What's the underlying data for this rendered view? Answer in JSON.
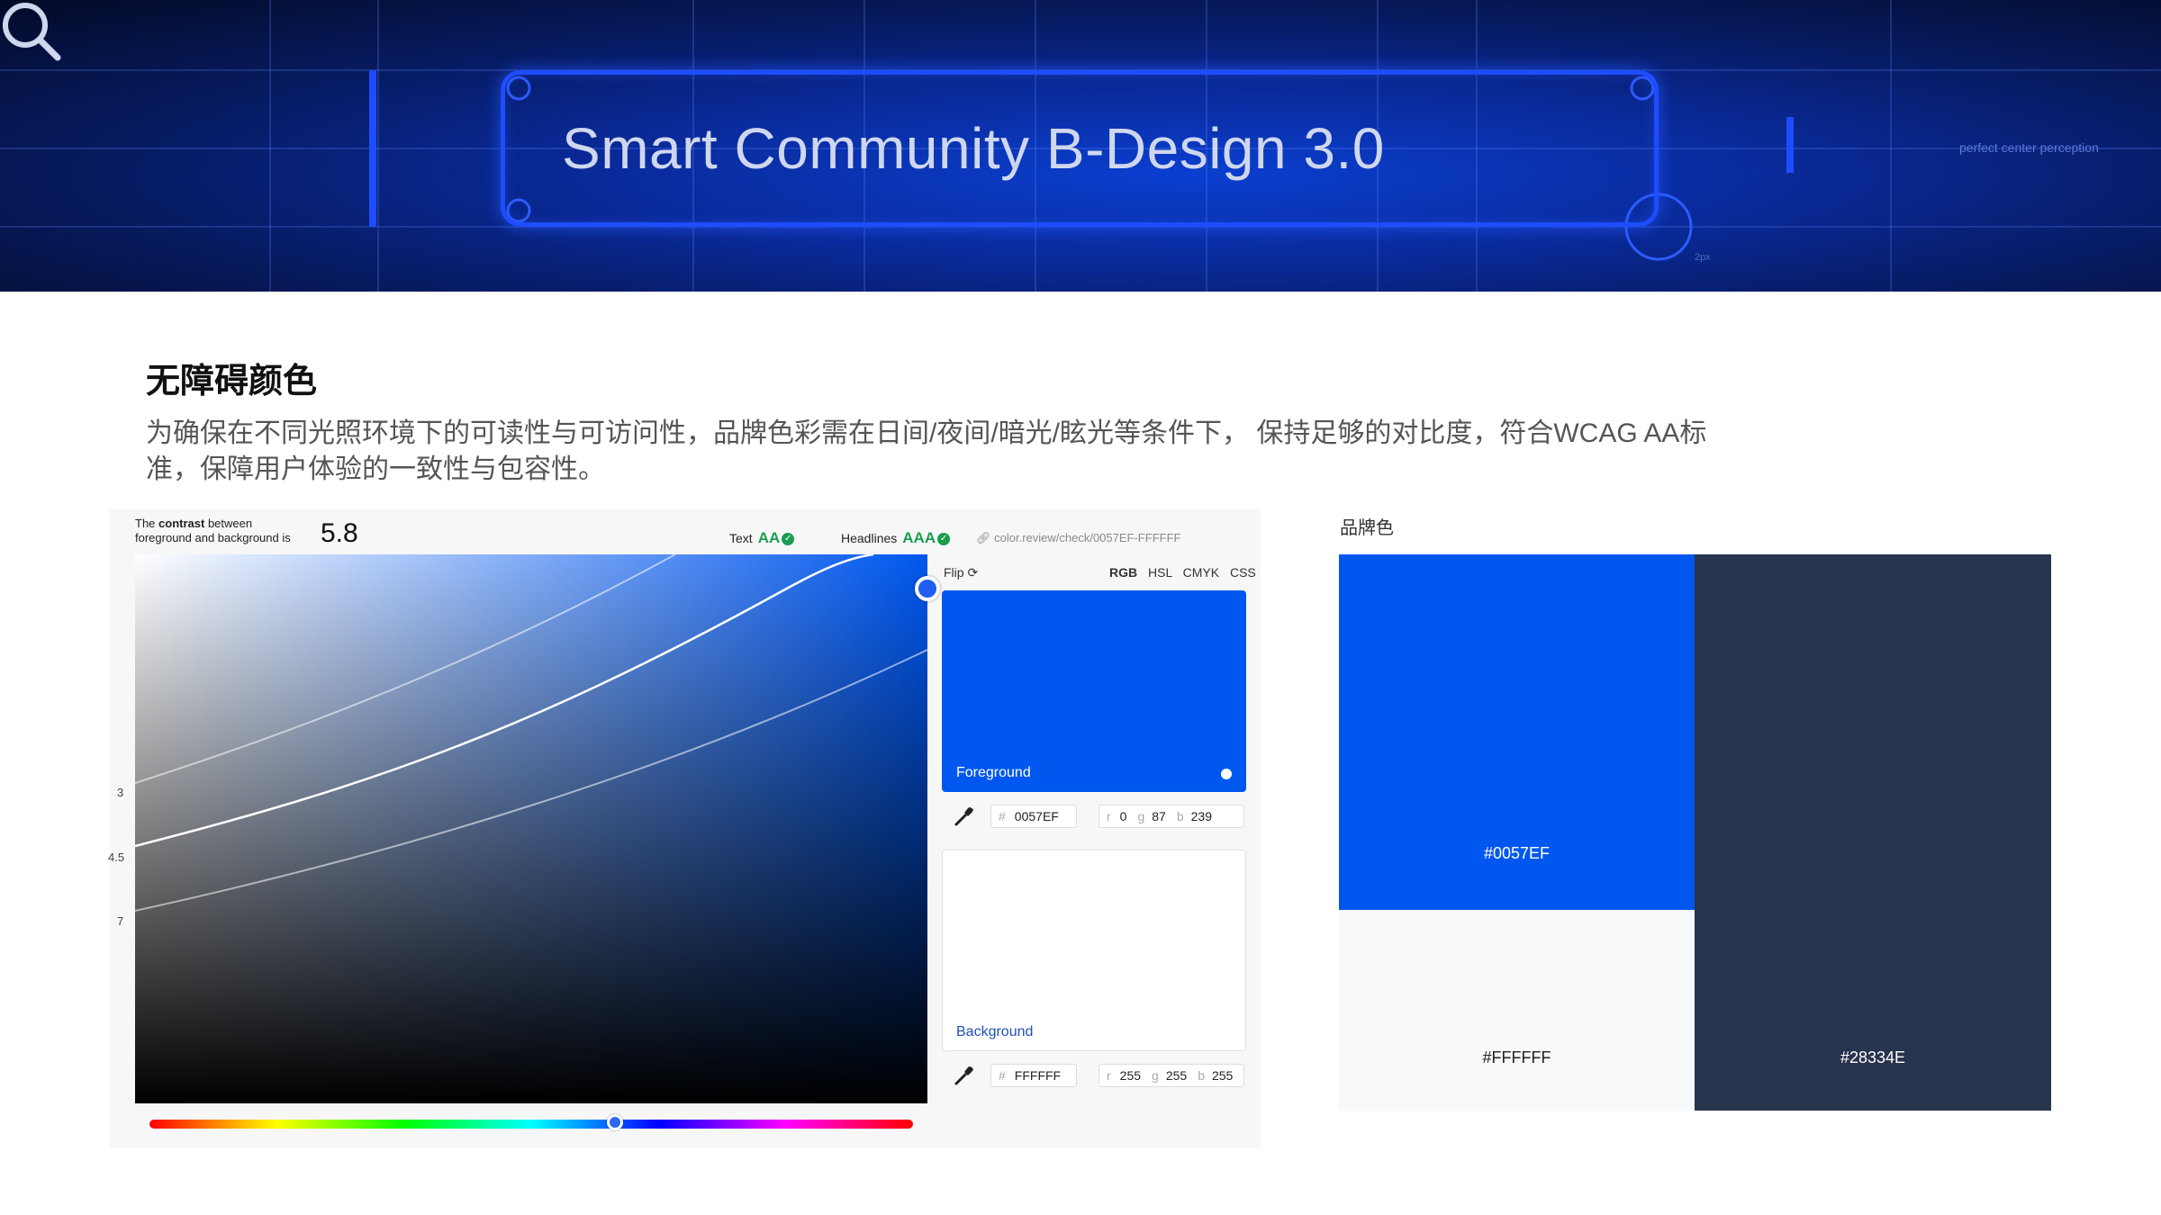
{
  "banner": {
    "title": "Smart Community B-Design 3.0",
    "right_text": "perfect center perception",
    "small_px": "2px",
    "icon": "search-icon"
  },
  "section": {
    "title": "无障碍颜色",
    "description": "为确保在不同光照环境下的可读性与可访问性，品牌色彩需在日间/夜间/暗光/眩光等条件下， 保持足够的对比度，符合WCAG AA标准，保障用户体验的一致性与包容性。"
  },
  "checker": {
    "contrast_prefix": "The",
    "contrast_bold": "contrast",
    "contrast_line1_suffix": "between",
    "contrast_line2": "foreground and background is",
    "contrast_value": "5.8",
    "text_label": "Text",
    "text_grade": "AA",
    "headlines_label": "Headlines",
    "headlines_grade": "AAA",
    "link": "color.review/check/0057EF-FFFFFF",
    "y_ticks": [
      "3",
      "4.5",
      "7"
    ],
    "hue_level": 0.61,
    "flip_label": "Flip",
    "modes": [
      "RGB",
      "HSL",
      "CMYK",
      "CSS"
    ],
    "foreground": {
      "label": "Foreground",
      "hex": "0057EF",
      "r": "0",
      "g": "87",
      "b": "239",
      "color": "#0057EF"
    },
    "background": {
      "label": "Background",
      "hex": "FFFFFF",
      "r": "255",
      "g": "255",
      "b": "255",
      "color": "#FFFFFF"
    },
    "hash": "#",
    "r_label": "r",
    "g_label": "g",
    "b_label": "b"
  },
  "brand": {
    "title": "品牌色",
    "swatches": [
      {
        "hex": "#0057EF",
        "color": "#0057EF",
        "text_color": "#ffffff"
      },
      {
        "hex": "#FFFFFF",
        "color": "#F8F9FA",
        "text_color": "#222222"
      },
      {
        "hex": "#28334E",
        "color": "#28334E",
        "text_color": "#ffffff"
      }
    ]
  }
}
